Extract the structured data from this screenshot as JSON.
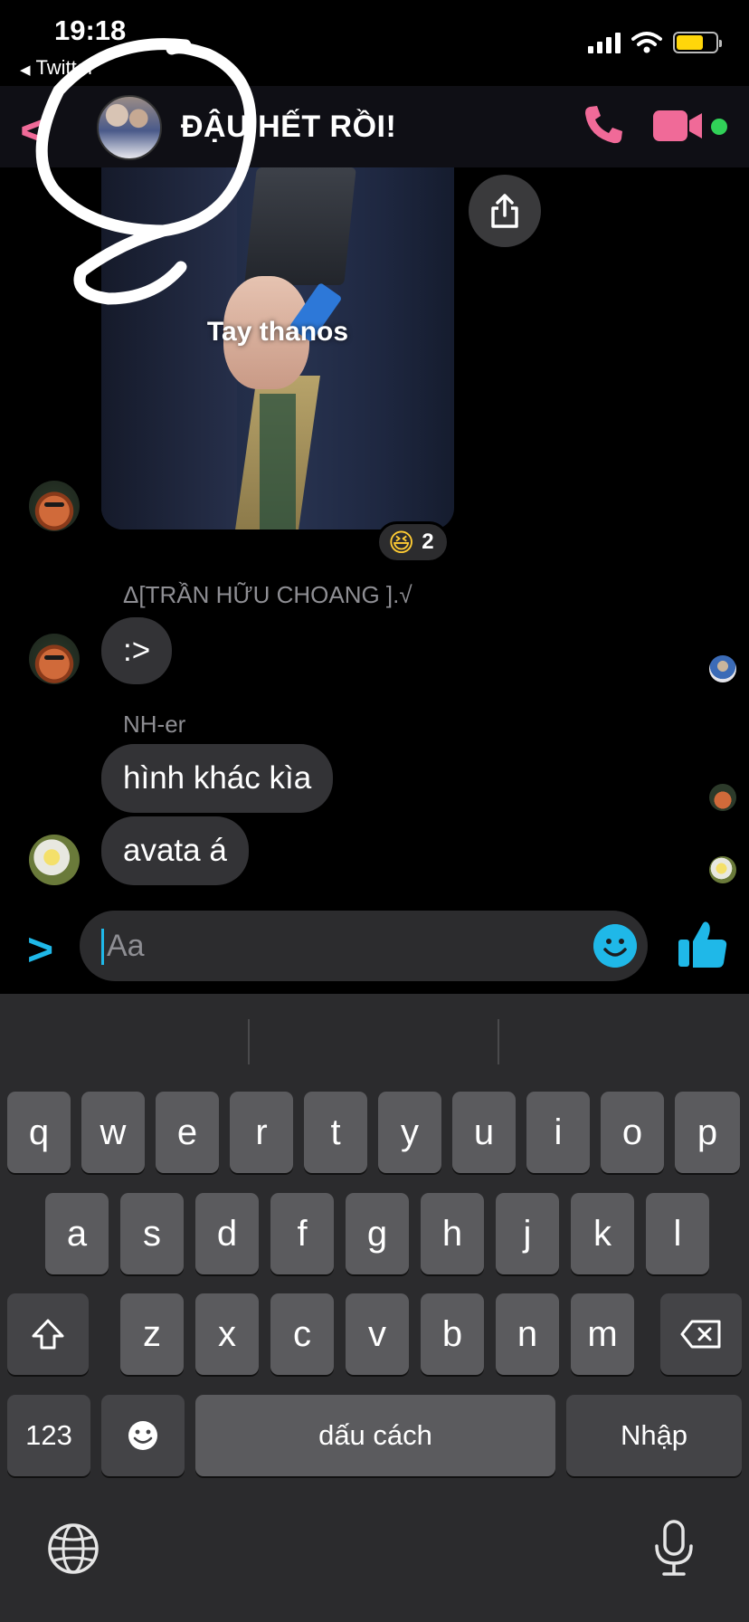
{
  "status_bar": {
    "time": "19:18",
    "back_app": "Twitter"
  },
  "header": {
    "title": "ĐẬU HẾT RỒI!"
  },
  "messages": {
    "media_caption": "Tay thanos",
    "reaction": {
      "emoji": "😆",
      "count": "2"
    },
    "sender1": "Δ[TRẦN HỮU CHOANG ].√",
    "msg1": ":>",
    "sender2": "NH-er",
    "msg2": "hình khác kìa",
    "msg3": "avata á"
  },
  "composer": {
    "placeholder": "Aa"
  },
  "keyboard": {
    "row1": [
      "q",
      "w",
      "e",
      "r",
      "t",
      "y",
      "u",
      "i",
      "o",
      "p"
    ],
    "row2": [
      "a",
      "s",
      "d",
      "f",
      "g",
      "h",
      "j",
      "k",
      "l"
    ],
    "row3": [
      "z",
      "x",
      "c",
      "v",
      "b",
      "n",
      "m"
    ],
    "numbers": "123",
    "space": "dấu cách",
    "return": "Nhập"
  },
  "colors": {
    "accent_pink": "#f06a98",
    "accent_blue": "#1fb8e8",
    "online_green": "#31d158"
  }
}
